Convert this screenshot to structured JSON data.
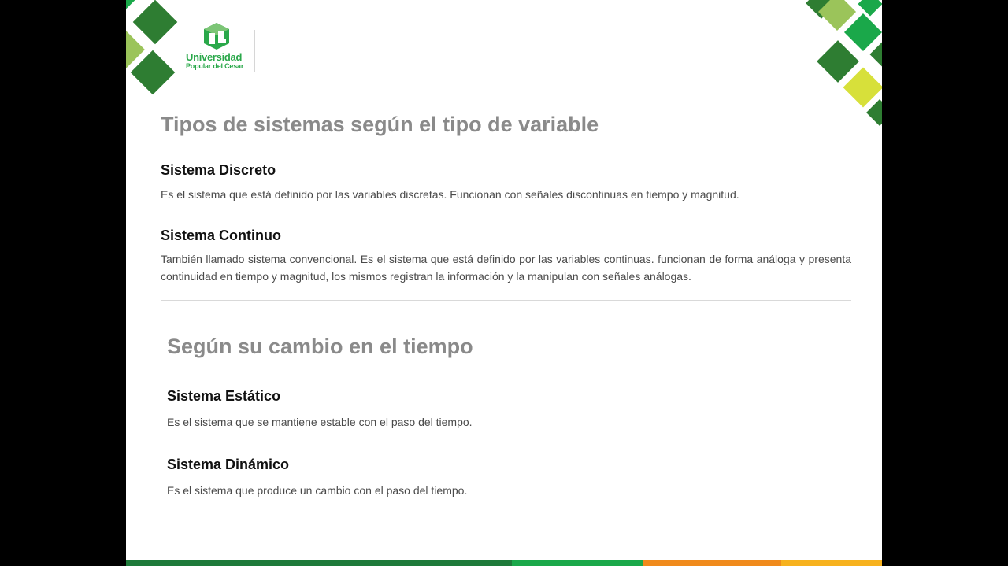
{
  "logo": {
    "name": "Universidad",
    "subname": "Popular del Cesar"
  },
  "section1": {
    "title": "Tipos de sistemas según el tipo de variable",
    "items": [
      {
        "title": "Sistema Discreto",
        "description": "Es el sistema que está definido por las variables discretas. Funcionan con señales discontinuas en tiempo y magnitud."
      },
      {
        "title": "Sistema Continuo",
        "description": "También llamado sistema convencional. Es el sistema que está definido por las variables continuas. funcionan de forma análoga y presenta continuidad en tiempo y magnitud, los mismos registran la información y la manipulan con señales análogas."
      }
    ]
  },
  "section2": {
    "title": "Según su cambio en el tiempo",
    "items": [
      {
        "title": "Sistema Estático",
        "description": "Es el sistema que se mantiene estable con el paso del tiempo."
      },
      {
        "title": "Sistema Dinámico",
        "description": "Es el sistema que produce un cambio con el paso del tiempo."
      }
    ]
  },
  "colors": {
    "dark_green": "#2e7d32",
    "green": "#1aa84a",
    "light_green": "#9bc45a",
    "lime": "#d7e03a",
    "orange": "#f08a1c",
    "yellow_orange": "#f7b21e",
    "title_gray": "#8a8a8a"
  }
}
